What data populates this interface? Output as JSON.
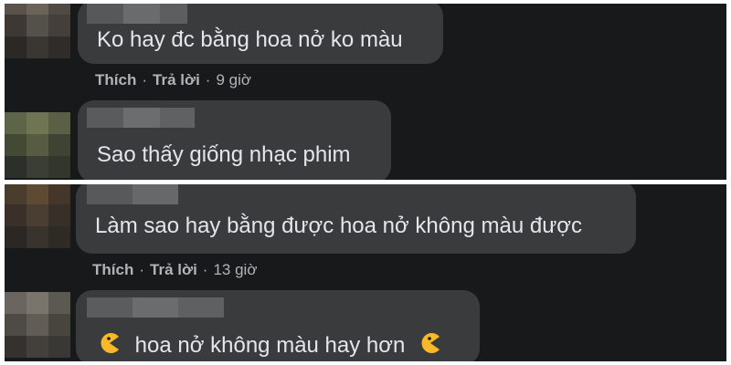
{
  "comments": [
    {
      "text": "Ko hay đc bằng hoa nở ko màu",
      "actions": {
        "like": "Thích",
        "reply": "Trả lời",
        "separator": "·",
        "time": "9 giờ"
      }
    },
    {
      "text": "Sao thấy giống nhạc phim"
    },
    {
      "text": "Làm sao hay bằng được hoa nở không màu được",
      "actions": {
        "like": "Thích",
        "reply": "Trả lời",
        "separator": "·",
        "time": "13 giờ"
      }
    },
    {
      "text": "hoa nở không màu hay hơn",
      "emoji": "pacman-emoji-icon"
    }
  ],
  "colors": {
    "background": "#18191a",
    "bubble": "#3a3b3c",
    "text": "#e4e6eb",
    "secondary_text": "#b0b3b8",
    "emoji": "#f7b928"
  }
}
